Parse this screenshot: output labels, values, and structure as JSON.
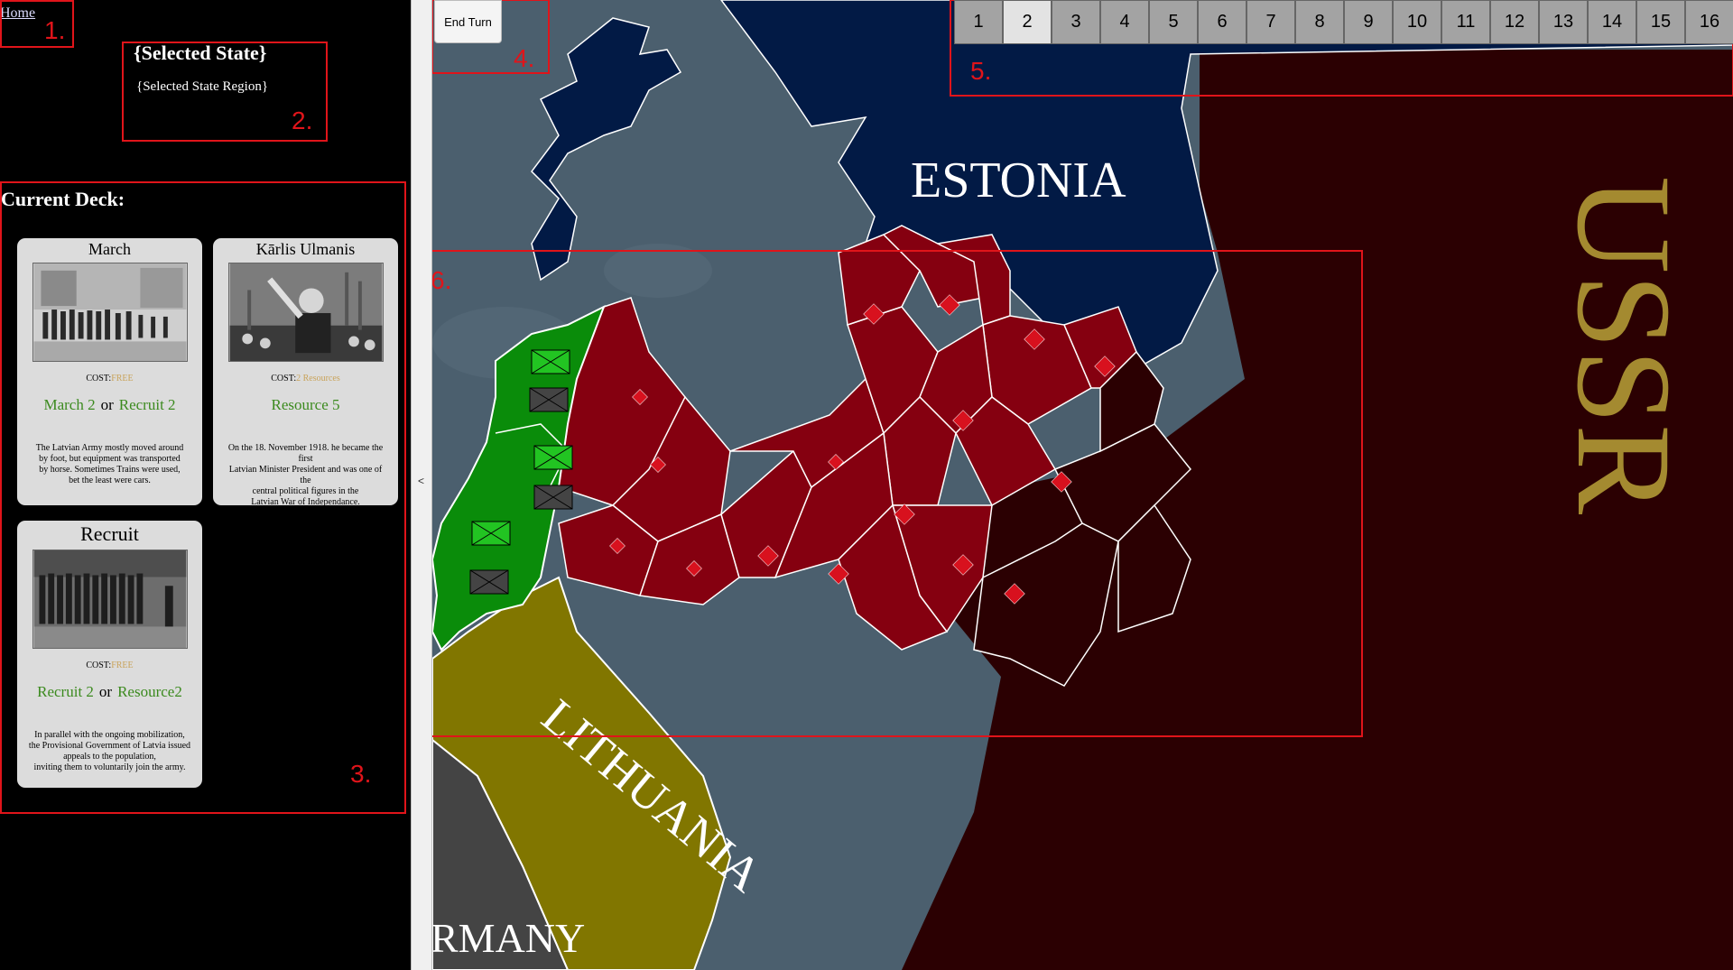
{
  "nav": {
    "home_label": "Home"
  },
  "state_info": {
    "title": "{Selected State}",
    "region": "{Selected State Region}"
  },
  "deck": {
    "title": "Current Deck:",
    "cost_label": "COST:",
    "or_label": "or",
    "cards": [
      {
        "title": "March",
        "cost": "FREE",
        "action_1": "March 2",
        "action_2": "Recruit 2",
        "desc_lines": [
          "The Latvian Army mostly moved around",
          "by foot, but equipment was transported",
          "by horse. Sometimes Trains were used,",
          "bet the least were cars."
        ]
      },
      {
        "title": "Kārlis Ulmanis",
        "cost": "2 Resources",
        "action_1": "Resource 5",
        "desc_lines": [
          "On the 18. November 1918. he became the first",
          "Latvian Minister President and was one of the",
          "central political figures in the",
          "Latvian War of Independance."
        ]
      },
      {
        "title": "Recruit",
        "cost": "FREE",
        "action_1": "Recruit 2",
        "action_2": "Resource2",
        "desc_lines": [
          "In parallel with the ongoing mobilization,",
          "the Provisional Government of Latvia issued",
          "appeals to the population,",
          "inviting them to voluntarily join the army."
        ]
      }
    ]
  },
  "controls": {
    "end_turn_label": "End Turn",
    "collapse_arrow": "<"
  },
  "turns": {
    "labels": [
      "1",
      "2",
      "3",
      "4",
      "5",
      "6",
      "7",
      "8",
      "9",
      "10",
      "11",
      "12",
      "13",
      "14",
      "15",
      "16"
    ],
    "active_index": 1
  },
  "map": {
    "labels": {
      "estonia": "ESTONIA",
      "ussr": "USSR",
      "lithuania": "LITHUANIA",
      "germany": "RMANY"
    },
    "colors": {
      "sea": "#4b5f6e",
      "estonia": "#021a45",
      "ussr": "#2b0002",
      "latvia": "#850010",
      "green": "#0a8c0a",
      "lithuania": "#817600",
      "germany": "#444444",
      "ussr_text": "#a48a30"
    }
  },
  "annotations": [
    "1.",
    "2.",
    "3.",
    "4.",
    "5.",
    "6."
  ]
}
